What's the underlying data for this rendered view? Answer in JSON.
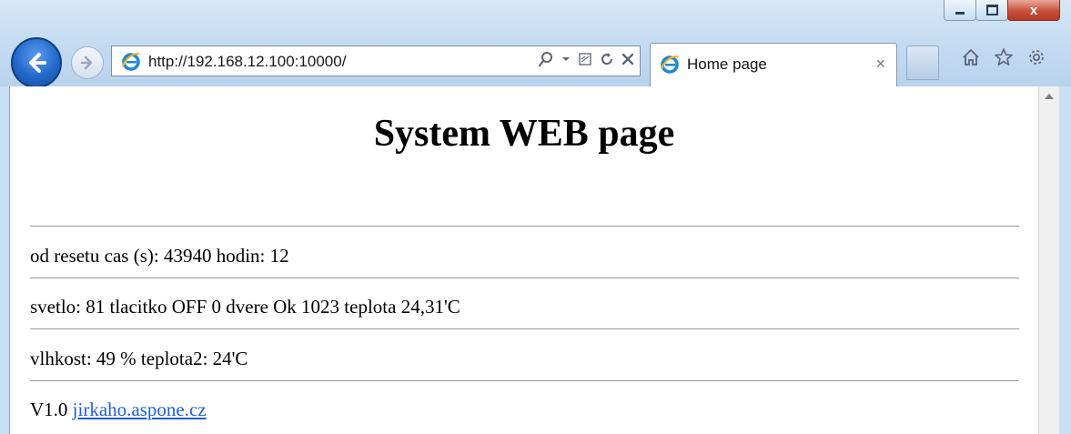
{
  "browser": {
    "address_url": "http://192.168.12.100:10000/",
    "tab_title": "Home page",
    "tab_close": "×",
    "window_close": "x",
    "icons": [
      "back-icon",
      "forward-icon",
      "ie-icon",
      "search-icon",
      "compat-icon",
      "refresh-icon",
      "stop-icon",
      "home-icon",
      "favorites-icon",
      "gear-icon"
    ],
    "accent_color": "#2169c9"
  },
  "page": {
    "title": "System WEB page",
    "line1": "od resetu cas (s): 43940 hodin: 12",
    "line2": "svetlo: 81 tlacitko OFF 0 dvere Ok 1023 teplota 24,31'C",
    "line3": "vlhkost: 49 % teplota2: 24'C",
    "version": "V1.0",
    "link_text": "jirkaho.aspone.cz",
    "link_color": "#1f5fd1"
  }
}
